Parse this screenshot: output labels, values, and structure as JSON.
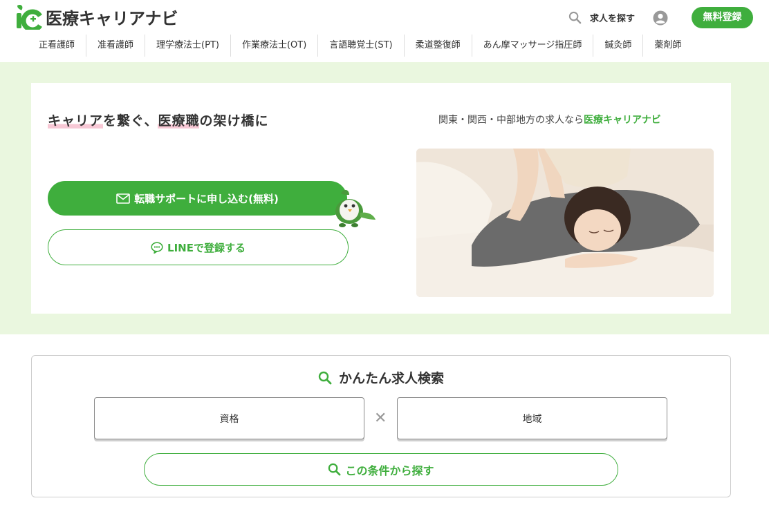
{
  "header": {
    "logo_text": "医療キャリアナビ",
    "logo_mark_text": "iC",
    "search_label": "求人を探す",
    "register_label": "無料登録",
    "nav": [
      "正看護師",
      "准看護師",
      "理学療法士(PT)",
      "作業療法士(OT)",
      "言語聴覚士(ST)",
      "柔道整復師",
      "あん摩マッサージ指圧師",
      "鍼灸師",
      "薬剤師"
    ]
  },
  "hero": {
    "tagline_parts": [
      "キャリア",
      "を繋ぐ、",
      "医療職",
      "の架け橋に"
    ],
    "subline_prefix": "関東・関西・中部地方の求人なら",
    "subline_brand": "医療キャリアナビ",
    "cta_primary_label": "転職サポートに申し込む(無料)",
    "cta_line_label": "LINEで登録する"
  },
  "search": {
    "title": "かんたん求人検索",
    "qualification_label": "資格",
    "times_symbol": "✕",
    "area_label": "地域",
    "submit_label": "この条件から探す"
  },
  "colors": {
    "brand_green": "#3fae3d",
    "hero_background": "#eaf7df",
    "highlight_pink": "#f7c8d5"
  }
}
